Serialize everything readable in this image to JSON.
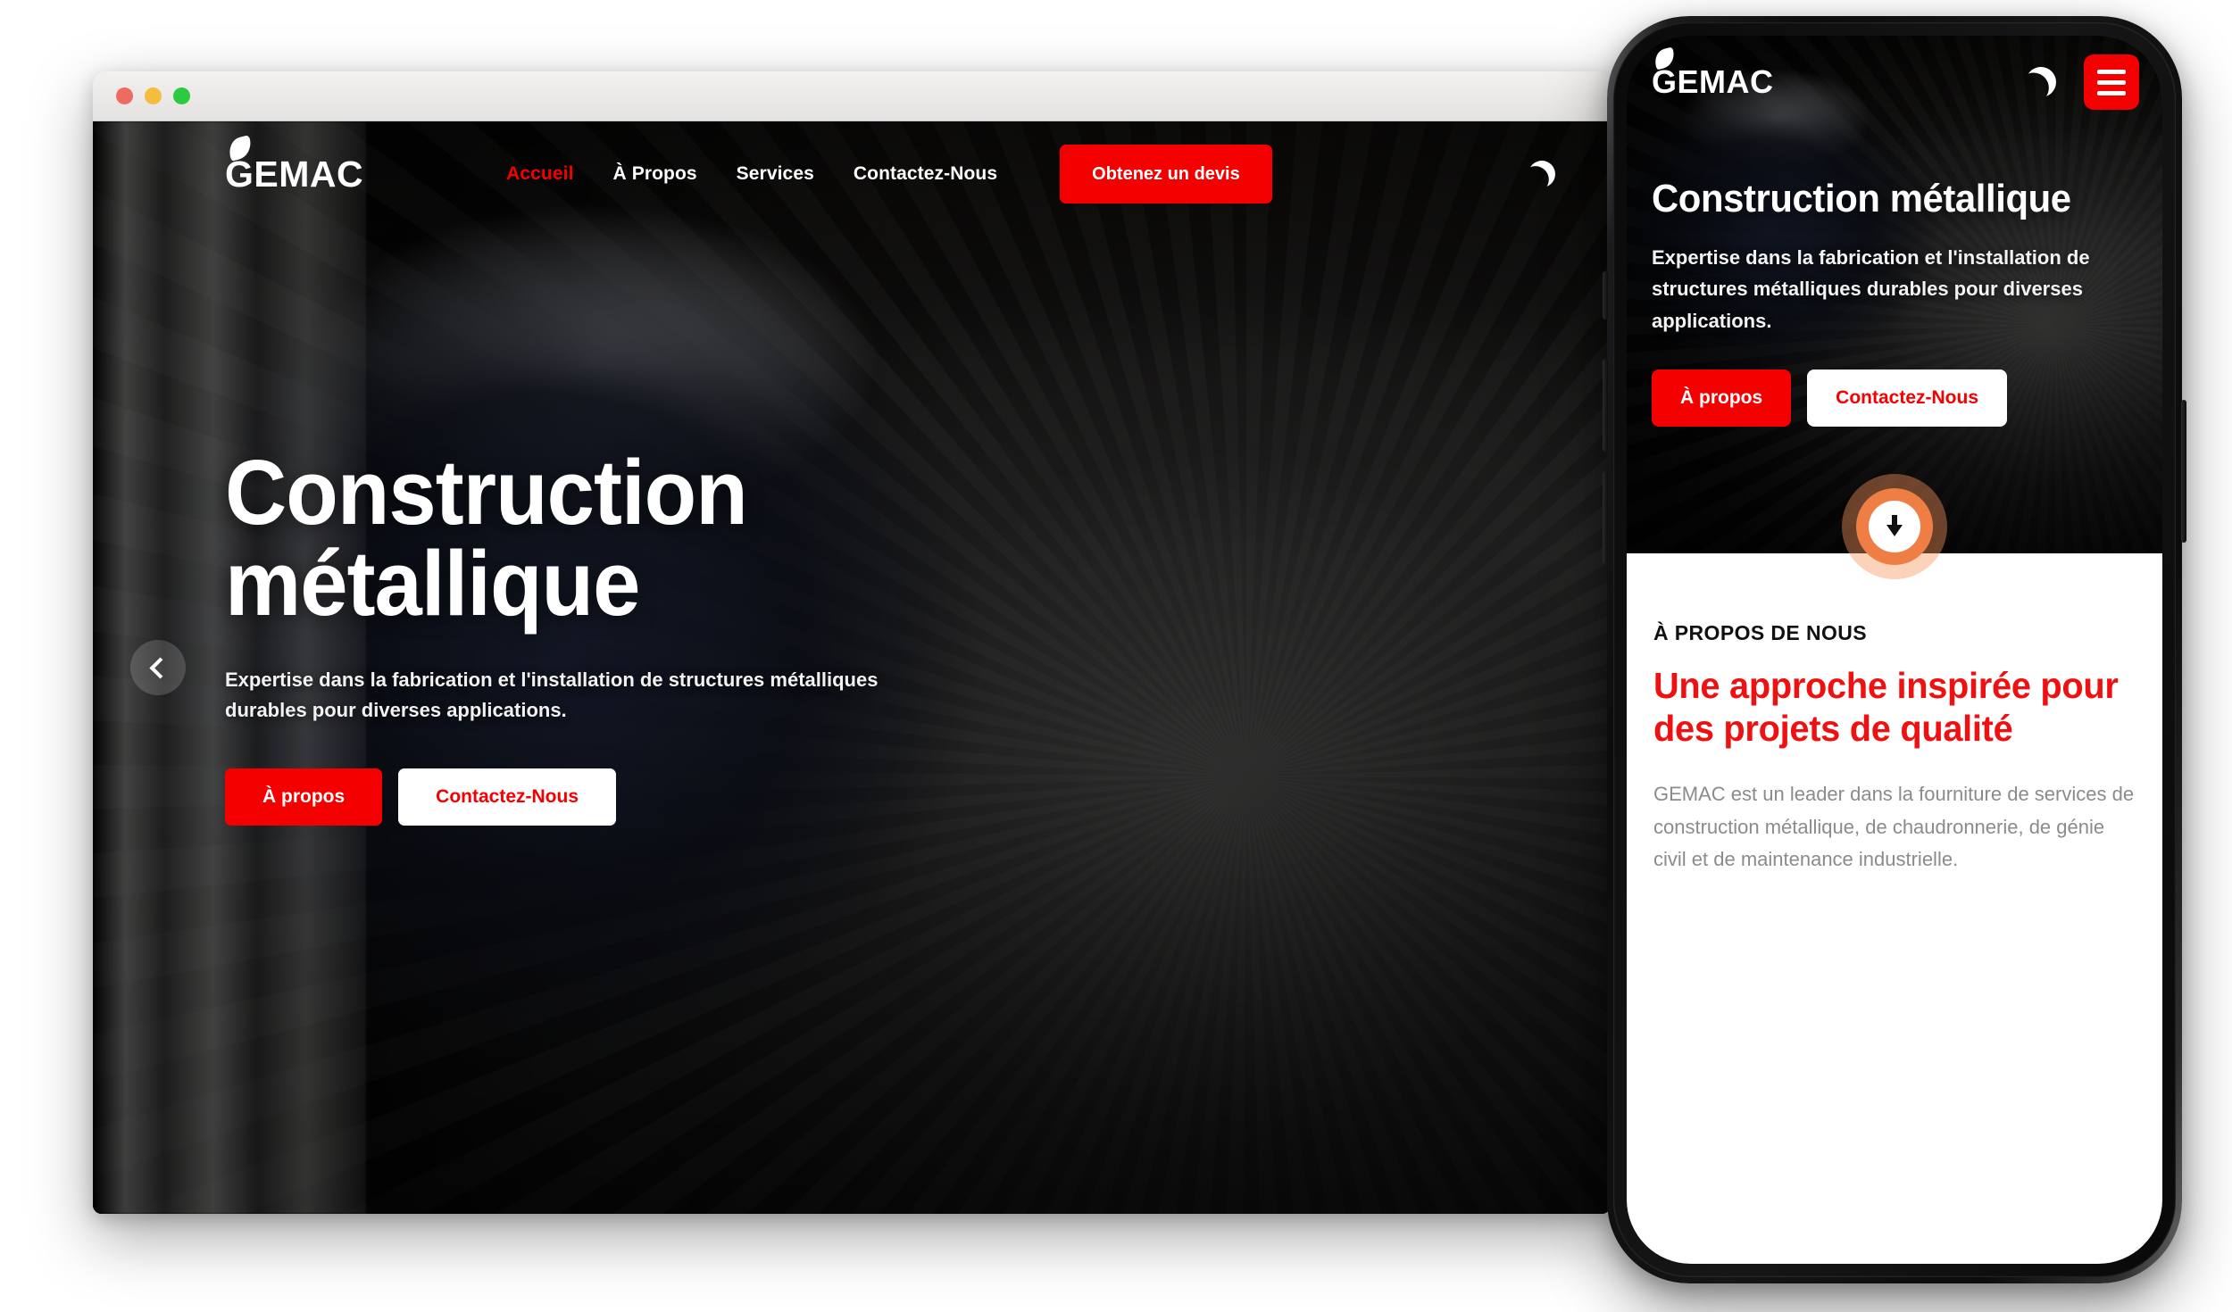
{
  "brand": {
    "name": "GEMAC",
    "accent_red": "#f40000",
    "accent_orange": "#ef7e45",
    "about_red": "#ef1111"
  },
  "window_chrome": {
    "close_label": "close",
    "minimize_label": "minimize",
    "zoom_label": "zoom"
  },
  "desktop": {
    "nav": {
      "links": [
        {
          "label": "Accueil",
          "active": true
        },
        {
          "label": "À Propos",
          "active": false
        },
        {
          "label": "Services",
          "active": false
        },
        {
          "label": "Contactez-Nous",
          "active": false
        }
      ],
      "cta_label": "Obtenez un devis",
      "theme_icon": "moon-icon"
    },
    "hero": {
      "title_line1": "Construction",
      "title_line2": "métallique",
      "subtitle": "Expertise dans la fabrication et l'installation de structures métalliques durables pour diverses applications.",
      "primary_button": "À propos",
      "secondary_button": "Contactez-Nous",
      "prev_icon": "chevron-left-icon"
    }
  },
  "phone": {
    "nav": {
      "theme_icon": "moon-icon",
      "menu_icon": "hamburger-menu-icon"
    },
    "hero": {
      "title": "Construction métallique",
      "subtitle": "Expertise dans la fabrication et l'installation de structures métalliques durables pour diverses applications.",
      "primary_button": "À propos",
      "secondary_button": "Contactez-Nous"
    },
    "scroll_down": {
      "icon": "arrow-down-icon"
    },
    "about": {
      "eyebrow": "À PROPOS DE NOUS",
      "title": "Une approche inspirée pour des projets de qualité",
      "body": "GEMAC est un leader dans la fourniture de services de construction métallique, de chaudronnerie, de génie civil et de maintenance industrielle."
    }
  }
}
